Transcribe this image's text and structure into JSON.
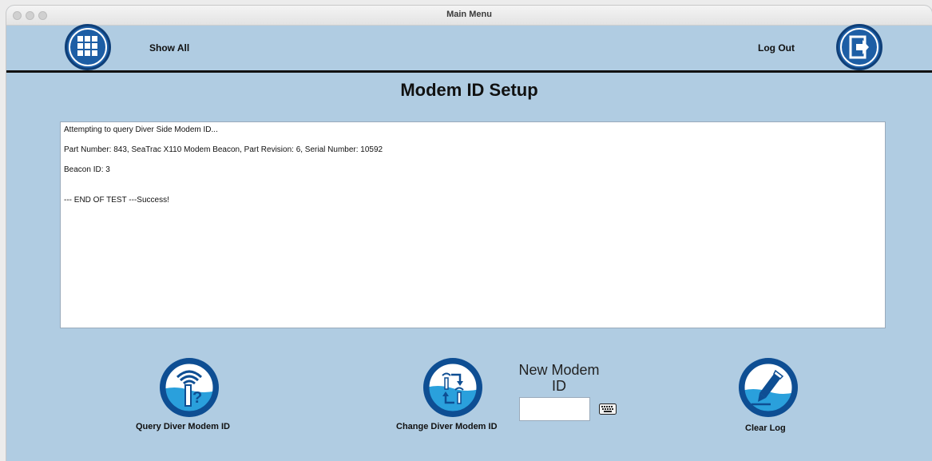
{
  "window": {
    "title": "Main Menu"
  },
  "header": {
    "show_all_label": "Show All",
    "logout_label": "Log Out",
    "show_all_icon": "grid-icon",
    "logout_icon": "exit-door-icon"
  },
  "page": {
    "title": "Modem ID Setup"
  },
  "log": {
    "lines": [
      "Attempting to query Diver Side Modem ID...",
      "Part Number: 843, SeaTrac X110 Modem Beacon, Part Revision: 6, Serial Number: 10592",
      "Beacon ID: 3",
      "--- END OF TEST ---Success!"
    ]
  },
  "actions": {
    "query_label": "Query Diver Modem ID",
    "change_label": "Change Diver Modem ID",
    "clear_label": "Clear Log"
  },
  "new_modem": {
    "label_line1": "New Modem",
    "label_line2": "ID",
    "value": ""
  },
  "colors": {
    "background": "#b0cce2",
    "button_blue": "#1d5ea5",
    "water_blue": "#2aa0dc"
  }
}
